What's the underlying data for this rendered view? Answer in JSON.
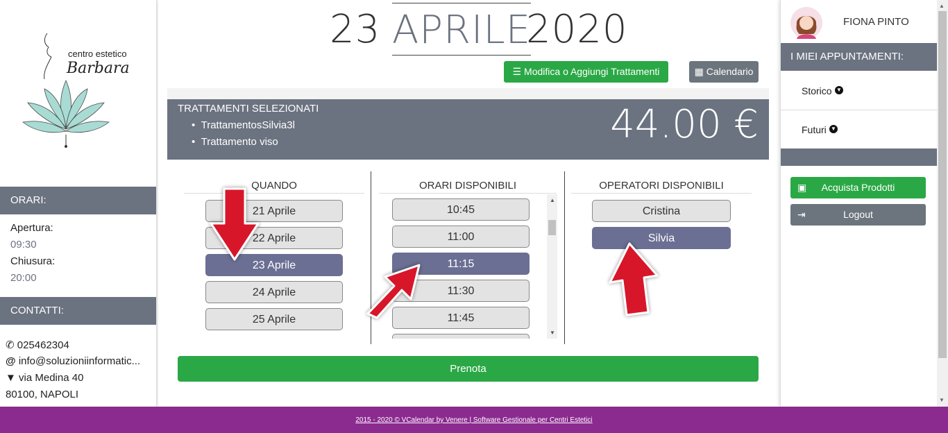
{
  "left": {
    "logo_line1": "centro estetico",
    "logo_line2": "Barbara",
    "hours_head": "ORARI:",
    "open_label": "Apertura:",
    "open_value": "09:30",
    "close_label": "Chiusura:",
    "close_value": "20:00",
    "contacts_head": "CONTATTI:",
    "phone": "025462304",
    "email": "info@soluzioniinformatic...",
    "address": "via Medina 40",
    "city": "80100, NAPOLI"
  },
  "date": {
    "day": "23",
    "month": "APRILE",
    "year": "2020"
  },
  "toolbar": {
    "edit_label": "Modifica o Aggiungi Trattamenti",
    "calendar_label": "Calendario"
  },
  "summary": {
    "title": "TRATTAMENTI SELEZIONATI",
    "items": [
      "TrattamentosSilvia3l",
      "Trattamento viso"
    ],
    "total": "44.00 €"
  },
  "when": {
    "title": "QUANDO",
    "dates": [
      "21 Aprile",
      "22 Aprile",
      "23 Aprile",
      "24 Aprile",
      "25 Aprile"
    ],
    "selected": 2
  },
  "times": {
    "title": "ORARI DISPONIBILI",
    "slots": [
      "10:45",
      "11:00",
      "11:15",
      "11:30",
      "11:45"
    ],
    "selected": 2
  },
  "operators": {
    "title": "OPERATORI DISPONIBILI",
    "names": [
      "Cristina",
      "Silvia"
    ],
    "selected": 1
  },
  "book_label": "Prenota",
  "right": {
    "user_name": "FIONA PINTO",
    "appointments_head": "I MIEI APPUNTAMENTI:",
    "history_label": "Storico",
    "future_label": "Futuri",
    "buy_label": "Acquista Prodotti",
    "logout_label": "Logout"
  },
  "footer": "2015 - 2020 © VCalendar by Venere | Software Gestionale per Centri Estetici",
  "colors": {
    "header_gray": "#6b7280",
    "selected": "#6b6f93",
    "green": "#2aa845",
    "footer": "#8b2a8f",
    "arrow": "#d7192b"
  }
}
